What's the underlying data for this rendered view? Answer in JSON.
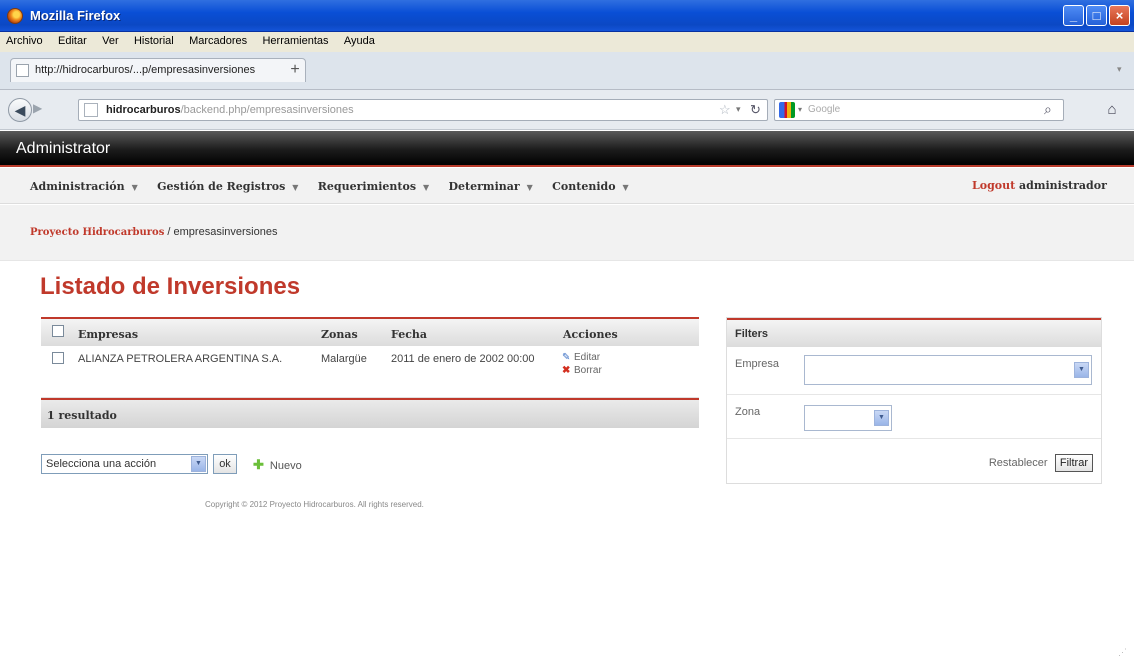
{
  "window": {
    "title": "Mozilla Firefox"
  },
  "menubar": [
    "Archivo",
    "Editar",
    "Ver",
    "Historial",
    "Marcadores",
    "Herramientas",
    "Ayuda"
  ],
  "tab": {
    "label": "http://hidrocarburos/...p/empresasinversiones",
    "new_tab": "+"
  },
  "navbar": {
    "url_host": "hidrocarburos",
    "url_path": "/backend.php/empresasinversiones",
    "search_placeholder": "Google"
  },
  "admin": {
    "brand": "Administrator",
    "menu": [
      {
        "label": "Administración"
      },
      {
        "label": "Gestión de Registros"
      },
      {
        "label": "Requerimientos"
      },
      {
        "label": "Determinar"
      },
      {
        "label": "Contenido"
      }
    ],
    "logout": {
      "link": "Logout",
      "user": "administrador"
    }
  },
  "breadcrumb": {
    "link": "Proyecto Hidrocarburos",
    "separator": " / ",
    "current": "empresasinversiones"
  },
  "page_title": "Listado de Inversiones",
  "table": {
    "headers": {
      "empresas": "Empresas",
      "zonas": "Zonas",
      "fecha": "Fecha",
      "acciones": "Acciones"
    },
    "rows": [
      {
        "empresa": "ALIANZA PETROLERA ARGENTINA S.A.",
        "zona": "Malargüe",
        "fecha": "2011 de enero de 2002 00:00",
        "edit": "Editar",
        "delete": "Borrar"
      }
    ],
    "footer": "1 resultado"
  },
  "batch": {
    "select_value": "Selecciona una acción",
    "ok": "ok",
    "new": "Nuevo"
  },
  "copyright": "Copyright © 2012 Proyecto Hidrocarburos. All rights reserved.",
  "filters": {
    "title": "Filters",
    "empresa_label": "Empresa",
    "zona_label": "Zona",
    "reset": "Restablecer",
    "submit": "Filtrar"
  },
  "colors": {
    "accent": "#c0392b",
    "titlebar": "#0a4fd6"
  }
}
